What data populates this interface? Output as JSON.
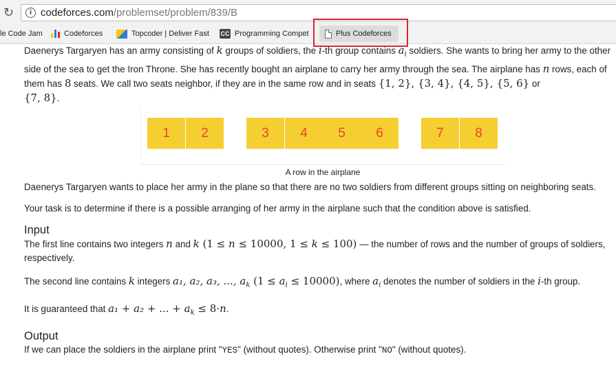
{
  "browser": {
    "url_domain": "codeforces.com",
    "url_path": "/problemset/problem/839/B",
    "reload_icon": "↻",
    "info_icon": "i"
  },
  "bookmarks": [
    {
      "label": "le Code Jam",
      "icon": "none"
    },
    {
      "label": "Codeforces",
      "icon": "codeforces-bars-icon"
    },
    {
      "label": "Topcoder | Deliver Fast",
      "icon": "topcoder-icon"
    },
    {
      "label": "Programming Compet",
      "icon": "cc-icon",
      "icon_text": "CC"
    },
    {
      "label": "Plus Codeforces",
      "icon": "page-icon"
    }
  ],
  "highlight_color": "#d9252e",
  "seat_colors": {
    "fill": "#f5cf32",
    "text": "#e8432b"
  },
  "problem": {
    "para1": {
      "a": "Daenerys Targaryen has an army consisting of ",
      "k": "k",
      "b": " groups of soldiers, the ",
      "i": "i",
      "c": "-th group contains ",
      "ai": "a",
      "ai_sub": "i",
      "d": " soldiers. She wants to bring her army to the other side of the sea to get the Iron Throne. She has recently bought an airplane to carry her army through the sea. The airplane has ",
      "n": "n",
      "e": " rows, each of them has ",
      "eight": "8",
      "f": " seats. We call two seats neighbor, if they are in the same row and in seats ",
      "sets": "{1, 2}, {3, 4}, {4, 5}, {5, 6}",
      "g": " or ",
      "last_set": "{7, 8}",
      "h": "."
    },
    "seats": [
      "1",
      "2",
      "3",
      "4",
      "5",
      "6",
      "7",
      "8"
    ],
    "caption": "A row in the airplane",
    "para2": "Daenerys Targaryen wants to place her army in the plane so that there are no two soldiers from different groups sitting on neighboring seats.",
    "para3": "Your task is to determine if there is a possible arranging of her army in the airplane such that the condition above is satisfied.",
    "input_heading": "Input",
    "input1": {
      "a": "The first line contains two integers ",
      "n": "n",
      "b": " and ",
      "k": "k",
      "c1": " (1 ≤ ",
      "n2": "n",
      "c2": " ≤ 10000, 1 ≤ ",
      "k2": "k",
      "c3": " ≤ 100)",
      "d": " — the number of rows and the number of groups of soldiers, respectively."
    },
    "input2": {
      "a": "The second line contains ",
      "k": "k",
      "b": " integers ",
      "seq": "a₁, a₂, a₃, ..., a",
      "seq_sub": "k",
      "c": " (1 ≤ ",
      "ai": "a",
      "ai_sub": "i",
      "c2": " ≤ 10000)",
      "d": ", where ",
      "ai2": "a",
      "ai2_sub": "i",
      "e": " denotes the number of soldiers in the ",
      "i": "i",
      "f": "-th group."
    },
    "input3": {
      "a": "It is guaranteed that ",
      "expr": "a₁ + a₂ + ... + a",
      "expr_sub": "k",
      "expr2": " ≤ 8·",
      "n": "n",
      "b": "."
    },
    "output_heading": "Output",
    "output1": {
      "a": "If we can place the soldiers in the airplane print \"",
      "yes": "YES",
      "b": "\" (without quotes). Otherwise print \"",
      "no": "NO",
      "c": "\" (without quotes)."
    }
  }
}
